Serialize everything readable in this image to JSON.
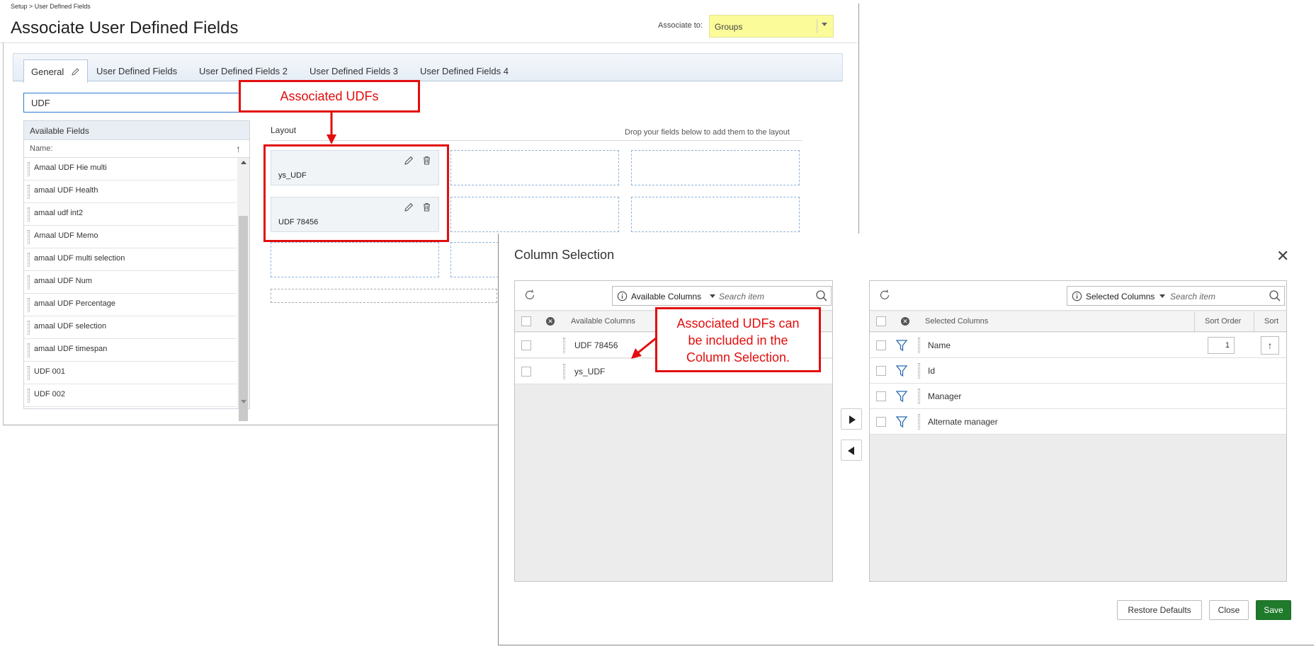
{
  "header": {
    "breadcrumb": "Setup > User Defined Fields",
    "title": "Associate User Defined Fields",
    "associate_label": "Associate to:",
    "associate_value": "Groups",
    "associate_bg": "#fbfb9a"
  },
  "tabs": [
    {
      "label": "General",
      "active": true
    },
    {
      "label": "User Defined Fields"
    },
    {
      "label": "User Defined Fields 2"
    },
    {
      "label": "User Defined Fields 3"
    },
    {
      "label": "User Defined Fields 4"
    }
  ],
  "filter": {
    "value": "UDF"
  },
  "available_fields": {
    "title": "Available Fields",
    "sort_header": "Name:",
    "items": [
      "Amaal UDF Hie multi",
      "amaal UDF Health",
      "amaal udf int2",
      "Amaal UDF Memo",
      "amaal UDF multi selection",
      "amaal UDF Num",
      "amaal UDF Percentage",
      "amaal UDF selection",
      "amaal UDF timespan",
      "UDF 001",
      "UDF 002"
    ]
  },
  "layout": {
    "label": "Layout",
    "hint": "Drop your fields below to add them to the layout",
    "cards": [
      "ys_UDF",
      "UDF 78456"
    ]
  },
  "callouts": {
    "associated": "Associated UDFs",
    "included_line1": "Associated UDFs can",
    "included_line2": "be included in the",
    "included_line3": "Column Selection.",
    "color": "#e20e0e"
  },
  "modal": {
    "title": "Column Selection",
    "available": {
      "dropdown": "Available Columns",
      "placeholder": "Search item",
      "column_header": "Available Columns",
      "rows": [
        "UDF 78456",
        "ys_UDF"
      ]
    },
    "selected": {
      "dropdown": "Selected Columns",
      "placeholder": "Search item",
      "column_header": "Selected Columns",
      "sort_order_header": "Sort Order",
      "sort_header": "Sort",
      "rows": [
        {
          "name": "Name",
          "sort_order": "1"
        },
        {
          "name": "Id"
        },
        {
          "name": "Manager"
        },
        {
          "name": "Alternate manager"
        }
      ]
    },
    "buttons": {
      "restore": "Restore Defaults",
      "close": "Close",
      "save": "Save"
    },
    "save_color": "#1f7a2b",
    "filter_icon_color": "#2b6cb0"
  }
}
